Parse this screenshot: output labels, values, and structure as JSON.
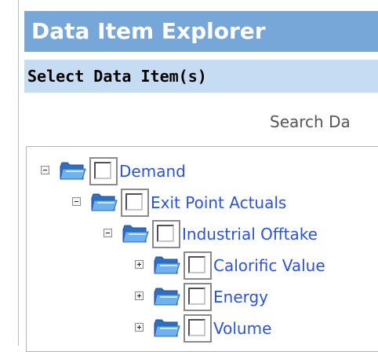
{
  "explorer": {
    "title": "Data Item Explorer",
    "subtitle": "Select Data Item(s)",
    "search_label": "Search Da"
  },
  "tree": {
    "nodes": [
      {
        "label": "Demand",
        "expanded": true,
        "checked": false,
        "level": 0
      },
      {
        "label": "Exit Point Actuals",
        "expanded": true,
        "checked": false,
        "level": 1
      },
      {
        "label": "Industrial Offtake",
        "expanded": true,
        "checked": false,
        "level": 2
      },
      {
        "label": "Calorific Value",
        "expanded": false,
        "checked": false,
        "level": 3
      },
      {
        "label": "Energy",
        "expanded": false,
        "checked": false,
        "level": 3
      },
      {
        "label": "Volume",
        "expanded": false,
        "checked": false,
        "level": 3
      }
    ]
  },
  "icons": {
    "expand": "expand-icon",
    "collapse": "collapse-icon",
    "folder": "folder-icon"
  },
  "colors": {
    "title_bar": "#77a6d8",
    "sub_bar": "#c6dcf2",
    "link": "#2a54d2"
  }
}
